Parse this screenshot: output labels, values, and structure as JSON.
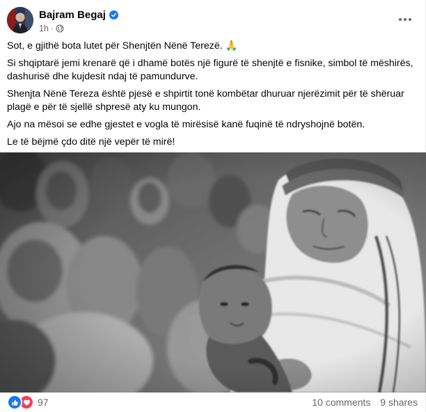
{
  "post": {
    "author": "Bajram Begaj",
    "verified_icon": "verified-badge-icon",
    "time": "1h",
    "separator": "·",
    "audience_icon": "globe-icon",
    "more_icon": "more-options-icon",
    "paragraphs": [
      "Sot, e gjithë bota lutet për Shenjtën Nënë Terezë. 🙏",
      "Si shqiptarë jemi krenarë që i dhamë botës një figurë të shenjtë e fisnike, simbol të mëshirës, dashurisë dhe kujdesit ndaj të pamundurve.",
      "Shenjta Nënë Tereza është pjesë e shpirtit tonë kombëtar dhuruar njerëzimit për të shëruar plagë e për të sjellë shpresë aty ku mungon.",
      "Ajo na mësoi se edhe gjestet e vogla të mirësisë kanë fuqinë të ndryshojnë botën.",
      "Le të bëjmë çdo ditë një vepër të mirë!"
    ]
  },
  "footer": {
    "reactions": [
      "like",
      "love"
    ],
    "reaction_count": "97",
    "comments": "10 comments",
    "shares": "9 shares"
  },
  "colors": {
    "like": "#1877f2",
    "love": "#f33e58",
    "verified": "#1877f2",
    "secondary_text": "#65676b"
  }
}
